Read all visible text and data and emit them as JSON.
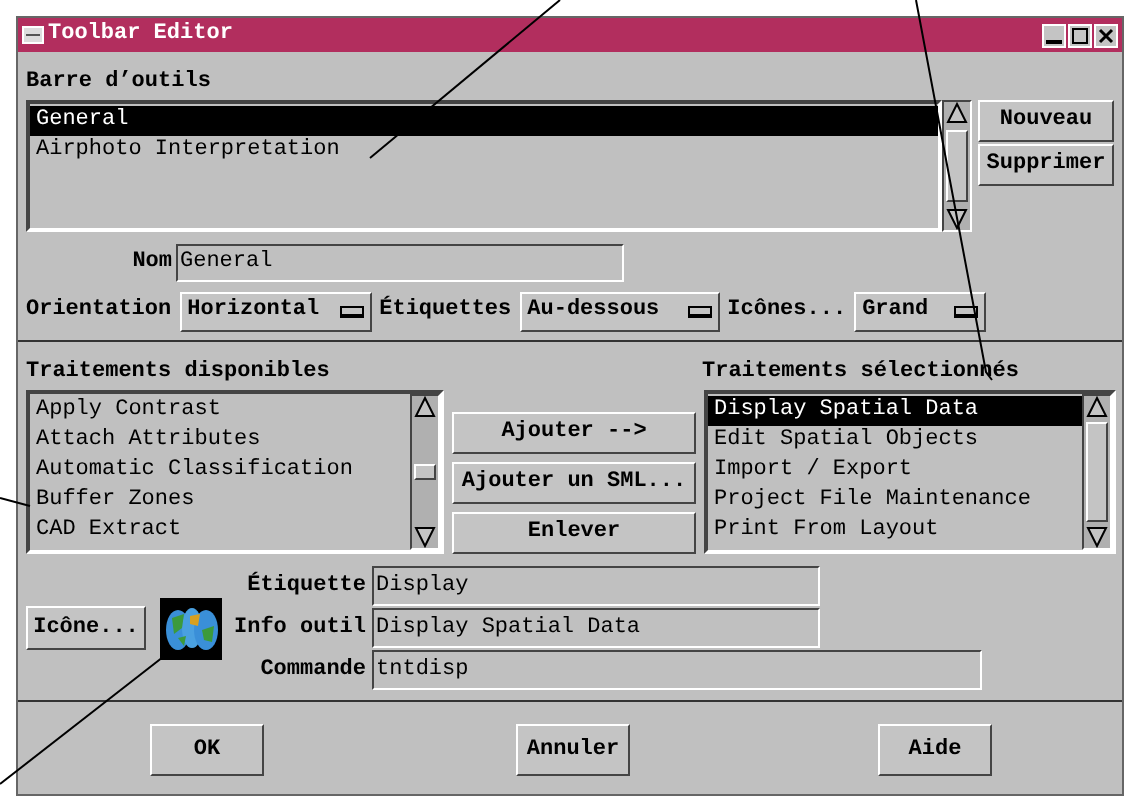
{
  "window": {
    "title": "Toolbar Editor"
  },
  "toolbars": {
    "label": "Barre d’outils",
    "items": [
      {
        "label": "General",
        "selected": true
      },
      {
        "label": "Airphoto Interpretation",
        "selected": false
      }
    ]
  },
  "toolbar_buttons": [
    "Nouveau",
    "Supprimer"
  ],
  "name": {
    "label": "Nom",
    "value": "General"
  },
  "options": [
    {
      "label": "Orientation",
      "value": "Horizontal"
    },
    {
      "label": "Étiquettes",
      "value": "Au-dessous"
    },
    {
      "label": "Icônes...",
      "value": "Grand"
    }
  ],
  "available": {
    "label": "Traitements disponibles",
    "items": [
      {
        "label": "Apply Contrast",
        "selected": false
      },
      {
        "label": "Attach Attributes",
        "selected": false
      },
      {
        "label": "Automatic Classification",
        "selected": false
      },
      {
        "label": "Buffer Zones",
        "selected": false
      },
      {
        "label": "CAD Extract",
        "selected": false
      }
    ]
  },
  "move_buttons": [
    "Ajouter -->",
    "Ajouter un SML...",
    "Enlever"
  ],
  "selected_processes": {
    "label": "Traitements sélectionnés",
    "items": [
      {
        "label": "Display Spatial Data",
        "selected": true
      },
      {
        "label": "Edit Spatial Objects",
        "selected": false
      },
      {
        "label": "Import / Export",
        "selected": false
      },
      {
        "label": "Project File Maintenance",
        "selected": false
      },
      {
        "label": "Print From Layout",
        "selected": false
      }
    ]
  },
  "icon_button": "Icône...",
  "fields": [
    {
      "label": "Étiquette",
      "value": "Display"
    },
    {
      "label": "Info outil",
      "value": "Display Spatial Data"
    },
    {
      "label": "Commande",
      "value": "tntdisp"
    }
  ],
  "buttons": [
    "OK",
    "Annuler",
    "Aide"
  ]
}
